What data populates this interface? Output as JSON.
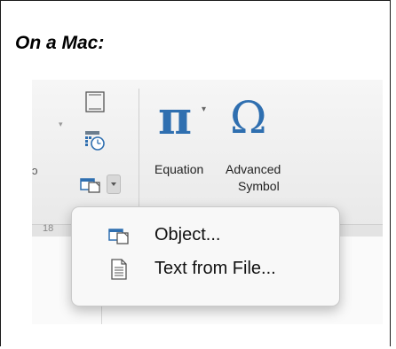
{
  "caption": "On a Mac:",
  "ribbon": {
    "left_edge_text": "ɔ",
    "ruler_number": "18",
    "equation_label": "Equation",
    "advanced_symbol_label_line1": "Advanced",
    "advanced_symbol_label_line2": "Symbol",
    "equation_glyph": "π",
    "symbol_glyph": "Ω",
    "dropdown_arrow": "▾"
  },
  "menu": {
    "items": [
      {
        "label": "Object...",
        "icon": "object-icon"
      },
      {
        "label": "Text from File...",
        "icon": "document-icon"
      }
    ]
  },
  "colors": {
    "accent": "#2f6fb0",
    "ribbon_bg": "#eeeeee",
    "menu_bg": "#f8f8f8"
  }
}
